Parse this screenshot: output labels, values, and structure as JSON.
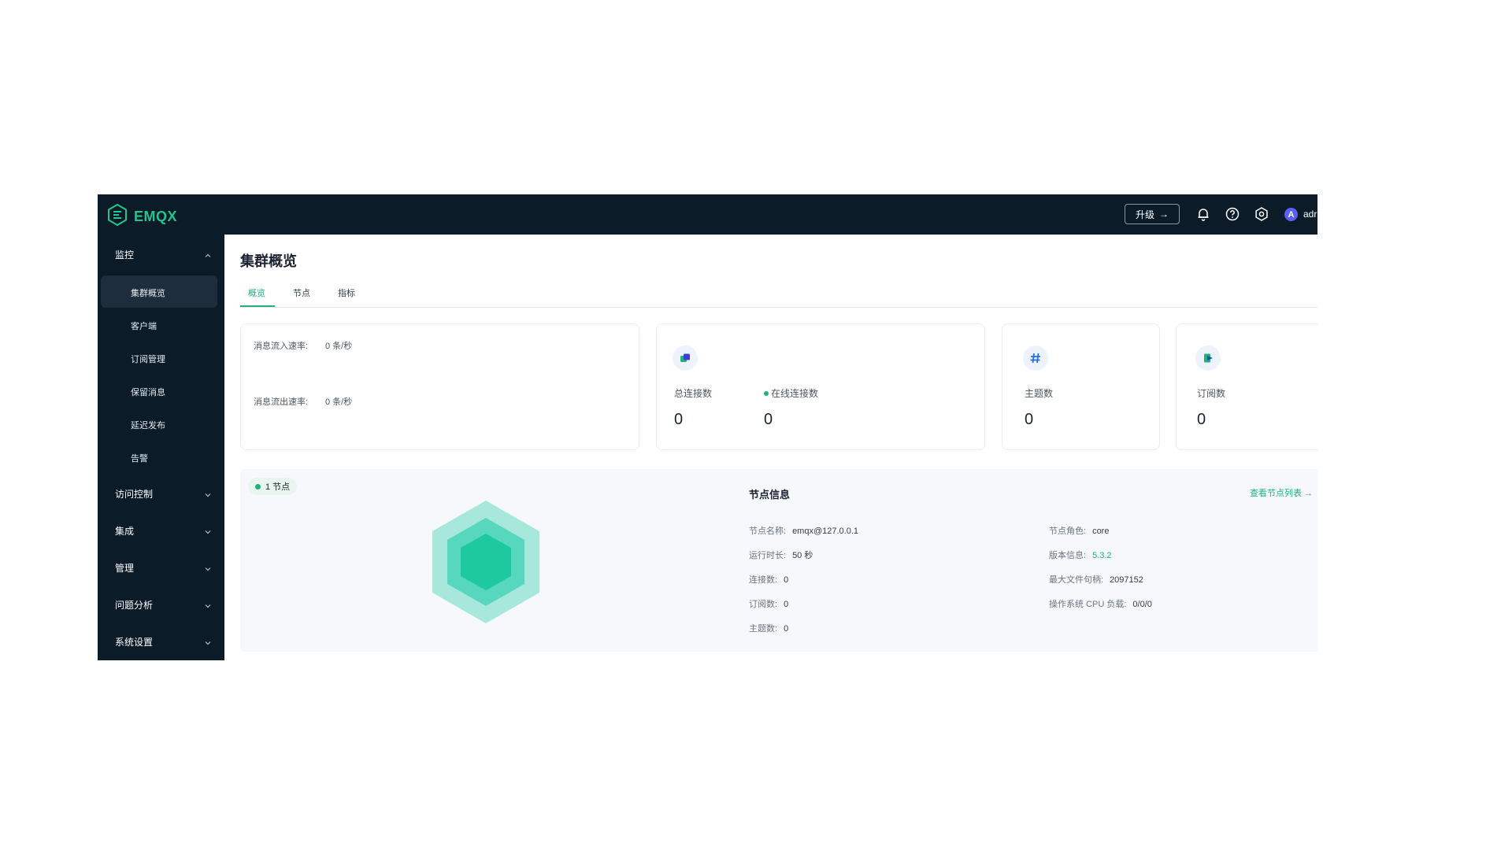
{
  "header": {
    "logo_text": "EMQX",
    "upgrade_label": "升级",
    "upgrade_arrow": "→",
    "avatar_letter": "A",
    "username": "adr",
    "brand_color": "#22b07a"
  },
  "sidebar": {
    "groups": [
      {
        "label": "监控",
        "expanded": true
      },
      {
        "label": "访问控制",
        "expanded": false
      },
      {
        "label": "集成",
        "expanded": false
      },
      {
        "label": "管理",
        "expanded": false
      },
      {
        "label": "问题分析",
        "expanded": false
      },
      {
        "label": "系统设置",
        "expanded": false
      }
    ],
    "monitor_items": [
      {
        "label": "集群概览",
        "active": true
      },
      {
        "label": "客户端"
      },
      {
        "label": "订阅管理"
      },
      {
        "label": "保留消息"
      },
      {
        "label": "延迟发布"
      },
      {
        "label": "告警"
      }
    ]
  },
  "main": {
    "title": "集群概览",
    "tabs": [
      {
        "label": "概览",
        "active": true
      },
      {
        "label": "节点"
      },
      {
        "label": "指标"
      }
    ],
    "rates": {
      "in_label": "消息流入速率:",
      "in_value": "0 条/秒",
      "out_label": "消息流出速率:",
      "out_value": "0 条/秒"
    },
    "stats": {
      "total_connections_label": "总连接数",
      "total_connections_value": "0",
      "online_connections_label": "在线连接数",
      "online_connections_value": "0",
      "topics_label": "主题数",
      "topics_value": "0",
      "subscriptions_label": "订阅数",
      "subscriptions_value": "0"
    },
    "nodes": {
      "badge": "1 节点",
      "title": "节点信息",
      "link": "查看节点列表 →",
      "left": [
        {
          "k": "节点名称:",
          "v": "emqx@127.0.0.1"
        },
        {
          "k": "运行时长:",
          "v": "50 秒"
        },
        {
          "k": "连接数:",
          "v": "0"
        },
        {
          "k": "订阅数:",
          "v": "0"
        },
        {
          "k": "主题数:",
          "v": "0"
        }
      ],
      "right": [
        {
          "k": "节点角色:",
          "v": "core"
        },
        {
          "k": "版本信息:",
          "v": "5.3.2"
        },
        {
          "k": "最大文件句柄:",
          "v": "2097152"
        },
        {
          "k": "操作系统 CPU 负载:",
          "v": "0/0/0"
        }
      ]
    }
  }
}
